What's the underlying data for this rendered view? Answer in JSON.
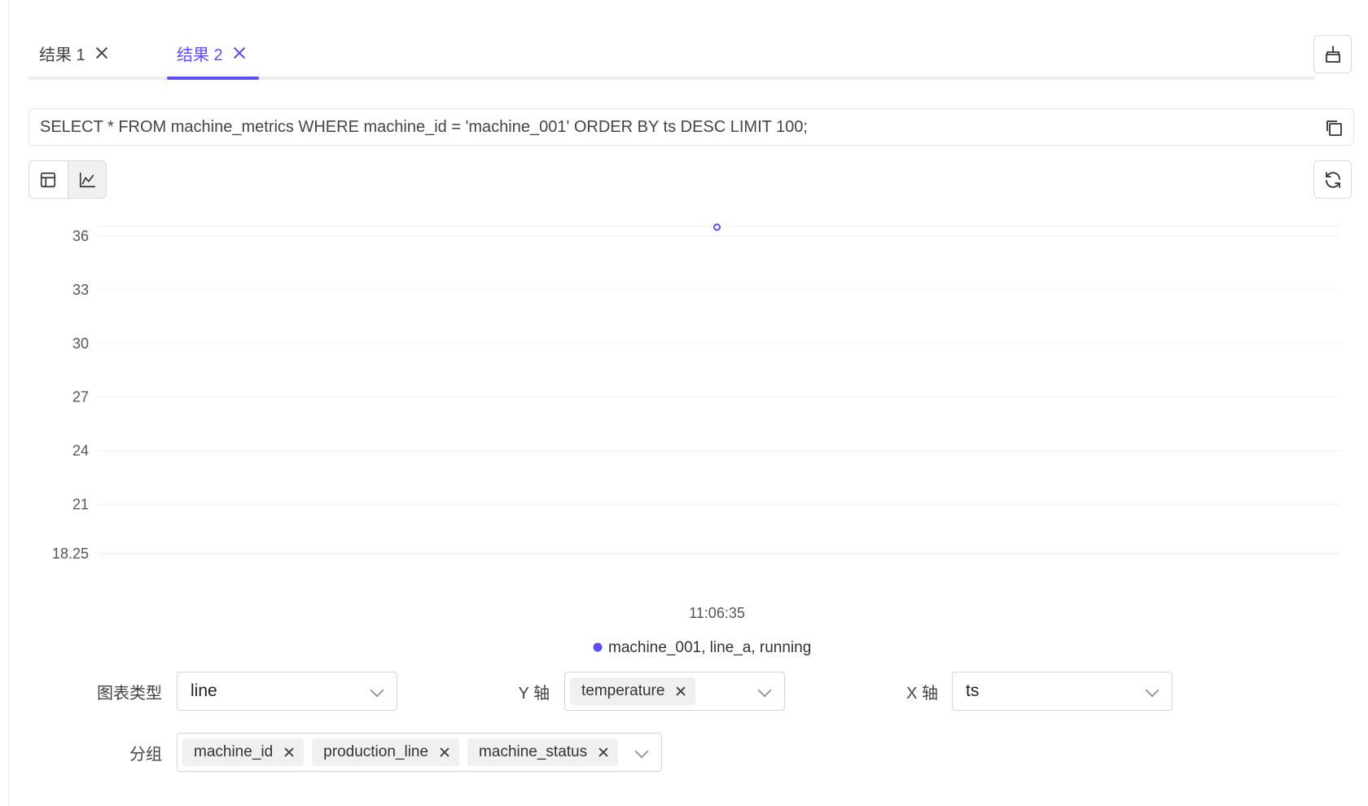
{
  "tabs": [
    {
      "label": "结果 1",
      "active": false
    },
    {
      "label": "结果 2",
      "active": true
    }
  ],
  "query": {
    "sql": "SELECT * FROM machine_metrics WHERE machine_id = 'machine_001' ORDER BY ts DESC LIMIT 100;"
  },
  "colors": {
    "accent": "#5b4ff5"
  },
  "icons": {
    "clear": "broom-icon",
    "copy": "copy-icon",
    "refresh": "refresh-icon",
    "table_view": "table-icon",
    "chart_view": "line-chart-icon"
  },
  "chart_data": {
    "type": "line",
    "title": "",
    "xlabel": "",
    "ylabel": "",
    "ylim": [
      18.25,
      37
    ],
    "yticks": [
      18.25,
      21,
      24,
      27,
      30,
      33,
      36
    ],
    "x": [
      "11:06:35"
    ],
    "series": [
      {
        "name": "machine_001, line_a, running",
        "values": [
          36.5
        ],
        "color": "#5b4ff5"
      }
    ],
    "grid": true,
    "legend_position": "bottom"
  },
  "form": {
    "chart_type": {
      "label": "图表类型",
      "value": "line"
    },
    "y_axis": {
      "label": "Y 轴",
      "tags": [
        "temperature"
      ]
    },
    "x_axis": {
      "label": "X 轴",
      "value": "ts"
    },
    "group": {
      "label": "分组",
      "tags": [
        "machine_id",
        "production_line",
        "machine_status"
      ]
    }
  }
}
